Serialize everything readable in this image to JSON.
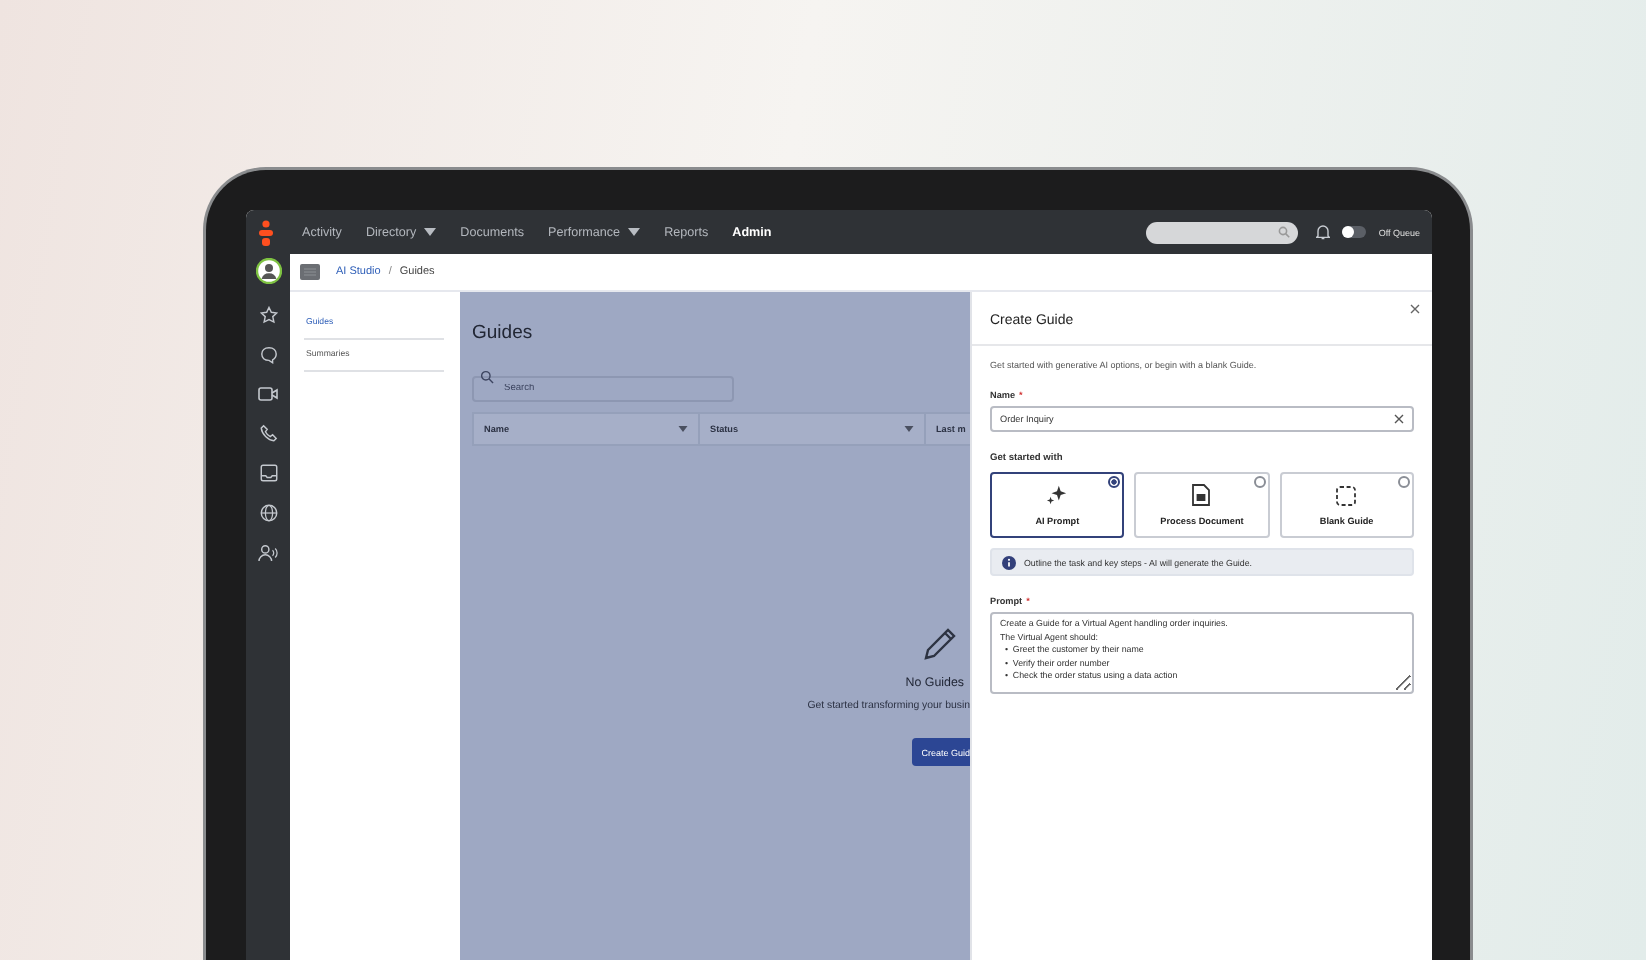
{
  "top_bar": {
    "nav": [
      {
        "label": "Activity",
        "dropdown": false,
        "selected": false
      },
      {
        "label": "Directory",
        "dropdown": true,
        "selected": false
      },
      {
        "label": "Documents",
        "dropdown": false,
        "selected": false
      },
      {
        "label": "Performance",
        "dropdown": true,
        "selected": false
      },
      {
        "label": "Reports",
        "dropdown": false,
        "selected": false
      },
      {
        "label": "Admin",
        "dropdown": false,
        "selected": true
      }
    ],
    "queue_toggle": {
      "label": "Off Queue",
      "on": false
    }
  },
  "breadcrumb_separator": "/",
  "breadcrumb": [
    {
      "label": "AI Studio",
      "link": true
    },
    {
      "label": "Guides",
      "link": false
    }
  ],
  "side_menu": [
    {
      "label": "Guides",
      "selected": true
    },
    {
      "label": "Summaries",
      "selected": false
    }
  ],
  "main": {
    "title": "Guides",
    "search": {
      "placeholder": "Search"
    },
    "columns": [
      "Name",
      "Status",
      "Last m"
    ],
    "empty": {
      "title": "No Guides",
      "text": "Get started transforming your busin",
      "button": "Create Guid"
    }
  },
  "dialog": {
    "title": "Create Guide",
    "intro": "Get started with generative AI options, or begin with a blank Guide.",
    "name": {
      "label": "Name",
      "required_mark": "*",
      "value": "Order Inquiry"
    },
    "start_label": "Get started with",
    "options": [
      {
        "kind": "ai",
        "label": "AI Prompt",
        "selected": true
      },
      {
        "kind": "document",
        "label": "Process Document",
        "selected": false
      },
      {
        "kind": "blank",
        "label": "Blank Guide",
        "selected": false
      }
    ],
    "info": "Outline the task and key steps - AI will generate the Guide.",
    "prompt": {
      "label": "Prompt",
      "required_mark": "*",
      "value": "Create a Guide for a Virtual Agent handling order inquiries.\nThe Virtual Agent should:\n  •  Greet the customer by their name\n  •  Verify their order number\n  •  Check the order status using a data action"
    }
  }
}
